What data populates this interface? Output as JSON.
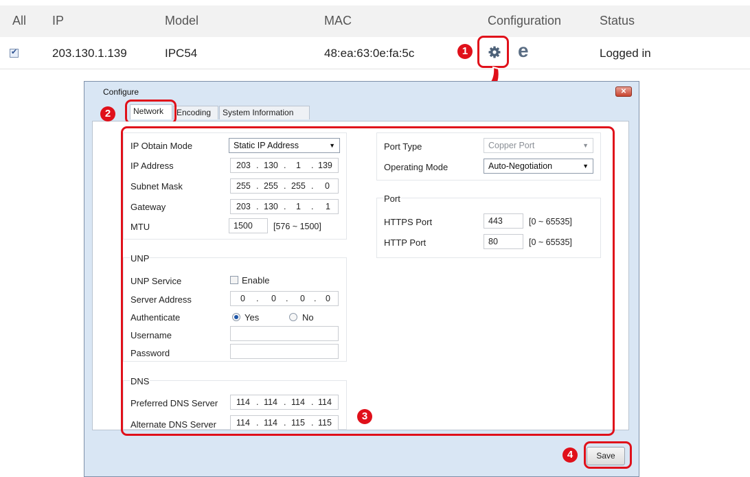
{
  "list": {
    "headers": {
      "all": "All",
      "ip": "IP",
      "model": "Model",
      "mac": "MAC",
      "configuration": "Configuration",
      "status": "Status"
    },
    "row": {
      "checked": true,
      "ip": "203.130.1.139",
      "model": "IPC54",
      "mac": "48:ea:63:0e:fa:5c",
      "status": "Logged in",
      "settings_icon": "gear-icon",
      "browser_icon": "ie-icon"
    }
  },
  "callouts": [
    "1",
    "2",
    "3",
    "4"
  ],
  "dialog": {
    "title": "Configure",
    "close_icon": "close-icon",
    "tabs": [
      "Network",
      "Encoding",
      "System Information"
    ],
    "active_tab": "Network",
    "ip_section": {
      "obtain_mode_label": "IP Obtain Mode",
      "obtain_mode_value": "Static IP Address",
      "ip_label": "IP Address",
      "ip": [
        "203",
        "130",
        "1",
        "139"
      ],
      "mask_label": "Subnet Mask",
      "mask": [
        "255",
        "255",
        "255",
        "0"
      ],
      "gateway_label": "Gateway",
      "gateway": [
        "203",
        "130",
        "1",
        "1"
      ],
      "mtu_label": "MTU",
      "mtu_value": "1500",
      "mtu_range": "[576 ~ 1500]"
    },
    "unp": {
      "title": "UNP",
      "service_label": "UNP Service",
      "enable_label": "Enable",
      "enabled": false,
      "server_label": "Server Address",
      "server": [
        "0",
        "0",
        "0",
        "0"
      ],
      "auth_label": "Authenticate",
      "yes_label": "Yes",
      "no_label": "No",
      "auth": "Yes",
      "username_label": "Username",
      "username": "",
      "password_label": "Password",
      "password": ""
    },
    "dns": {
      "title": "DNS",
      "preferred_label": "Preferred DNS Server",
      "preferred": [
        "114",
        "114",
        "114",
        "114"
      ],
      "alternate_label": "Alternate DNS Server",
      "alternate": [
        "114",
        "114",
        "115",
        "115"
      ]
    },
    "port_type": {
      "port_type_label": "Port Type",
      "port_type_value": "Copper Port",
      "operating_label": "Operating Mode",
      "operating_value": "Auto-Negotiation"
    },
    "port": {
      "title": "Port",
      "https_label": "HTTPS Port",
      "https_value": "443",
      "https_range": "[0 ~ 65535]",
      "http_label": "HTTP Port",
      "http_value": "80",
      "http_range": "[0 ~ 65535]"
    },
    "save_label": "Save"
  },
  "colors": {
    "callout_red": "#e0101a",
    "dialog_frame": "#d9e6f4",
    "header_bg": "#f2f2f2"
  }
}
